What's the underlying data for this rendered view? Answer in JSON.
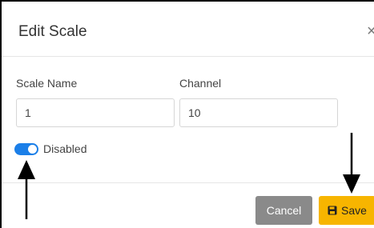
{
  "dialog": {
    "title": "Edit Scale",
    "close_glyph": "×"
  },
  "form": {
    "scale_name_label": "Scale Name",
    "scale_name_value": "1",
    "channel_label": "Channel",
    "channel_value": "10",
    "toggle_label": "Disabled",
    "toggle_on": true
  },
  "footer": {
    "cancel_label": "Cancel",
    "save_label": "Save",
    "save_icon": "floppy-disk-icon"
  },
  "colors": {
    "toggle_accent": "#1b7fe8",
    "save_button": "#f7b500",
    "cancel_button": "#8a8a8a"
  },
  "annotations": {
    "arrow_color": "#000000",
    "arrow_icon": "arrow-icon"
  }
}
